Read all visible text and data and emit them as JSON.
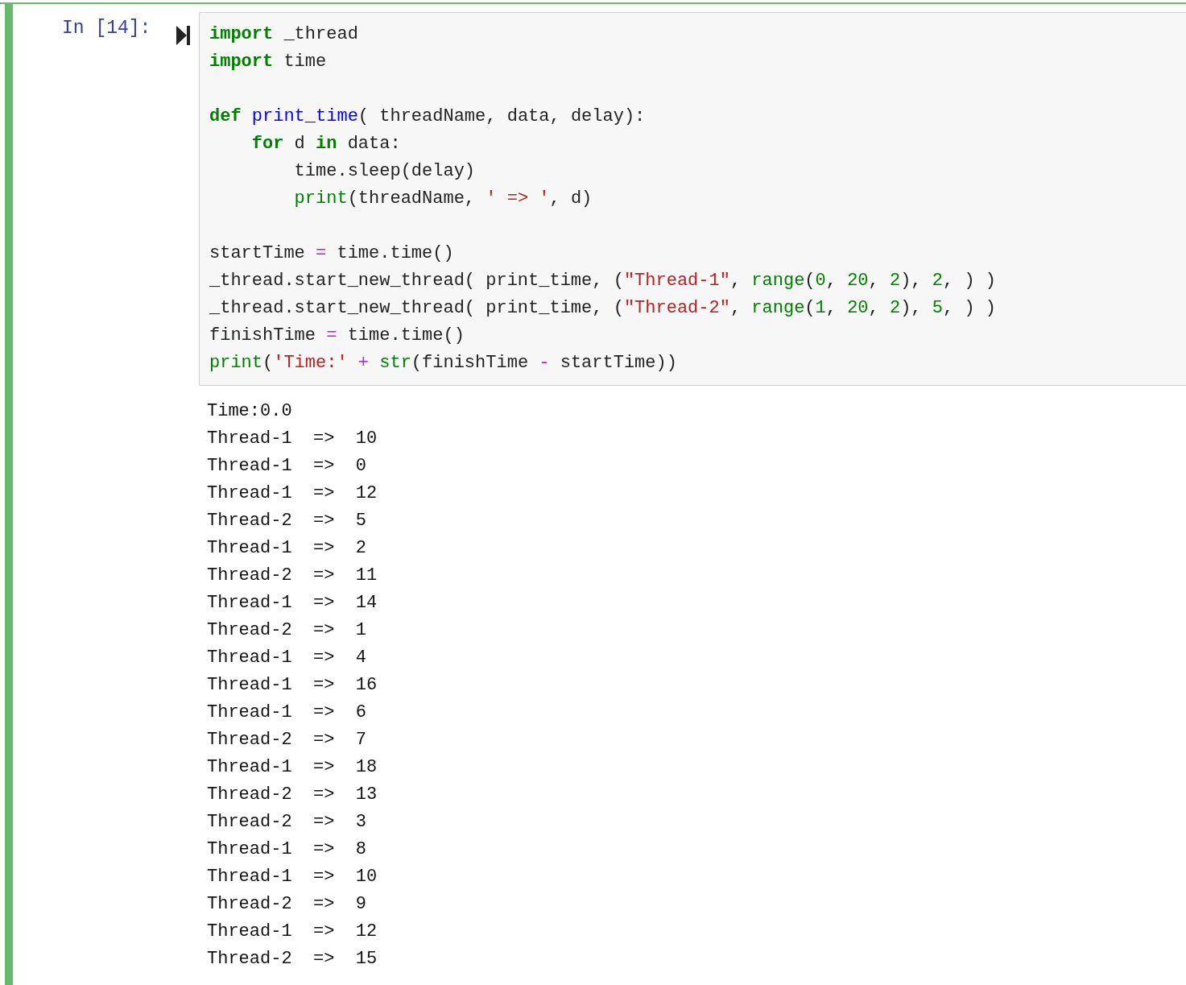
{
  "cell": {
    "prompt": "In [14]:",
    "code_lines": [
      {
        "kind": "code",
        "tokens": [
          {
            "kind": "keyword",
            "text": "import"
          },
          {
            "kind": "plain",
            "text": " _thread"
          }
        ]
      },
      {
        "kind": "code",
        "tokens": [
          {
            "kind": "keyword",
            "text": "import"
          },
          {
            "kind": "plain",
            "text": " time"
          }
        ]
      },
      {
        "kind": "blank"
      },
      {
        "kind": "code",
        "tokens": [
          {
            "kind": "keyword",
            "text": "def"
          },
          {
            "kind": "function",
            "text": " print_time"
          },
          {
            "kind": "plain",
            "text": "( threadName, data, delay):"
          }
        ]
      },
      {
        "kind": "code",
        "tokens": [
          {
            "kind": "keyword",
            "text": "    for"
          },
          {
            "kind": "plain",
            "text": " d "
          },
          {
            "kind": "keyword",
            "text": "in"
          },
          {
            "kind": "plain",
            "text": " data:"
          }
        ]
      },
      {
        "kind": "code",
        "tokens": [
          {
            "kind": "plain",
            "text": "        time.sleep(delay)"
          }
        ]
      },
      {
        "kind": "code",
        "tokens": [
          {
            "kind": "builtin",
            "text": "        print"
          },
          {
            "kind": "plain",
            "text": "(threadName, "
          },
          {
            "kind": "string",
            "text": "' => '"
          },
          {
            "kind": "plain",
            "text": ", d)"
          }
        ]
      },
      {
        "kind": "blank"
      },
      {
        "kind": "code",
        "tokens": [
          {
            "kind": "plain",
            "text": "startTime "
          },
          {
            "kind": "operator",
            "text": "="
          },
          {
            "kind": "plain",
            "text": " time.time()"
          }
        ]
      },
      {
        "kind": "code",
        "tokens": [
          {
            "kind": "plain",
            "text": "_thread.start_new_thread( print_time, ("
          },
          {
            "kind": "string",
            "text": "\"Thread-1\""
          },
          {
            "kind": "plain",
            "text": ", "
          },
          {
            "kind": "builtin",
            "text": "range"
          },
          {
            "kind": "plain",
            "text": "("
          },
          {
            "kind": "number",
            "text": "0"
          },
          {
            "kind": "plain",
            "text": ", "
          },
          {
            "kind": "number",
            "text": "20"
          },
          {
            "kind": "plain",
            "text": ", "
          },
          {
            "kind": "number",
            "text": "2"
          },
          {
            "kind": "plain",
            "text": "), "
          },
          {
            "kind": "number",
            "text": "2"
          },
          {
            "kind": "plain",
            "text": ", ) )"
          }
        ]
      },
      {
        "kind": "code",
        "tokens": [
          {
            "kind": "plain",
            "text": "_thread.start_new_thread( print_time, ("
          },
          {
            "kind": "string",
            "text": "\"Thread-2\""
          },
          {
            "kind": "plain",
            "text": ", "
          },
          {
            "kind": "builtin",
            "text": "range"
          },
          {
            "kind": "plain",
            "text": "("
          },
          {
            "kind": "number",
            "text": "1"
          },
          {
            "kind": "plain",
            "text": ", "
          },
          {
            "kind": "number",
            "text": "20"
          },
          {
            "kind": "plain",
            "text": ", "
          },
          {
            "kind": "number",
            "text": "2"
          },
          {
            "kind": "plain",
            "text": "), "
          },
          {
            "kind": "number",
            "text": "5"
          },
          {
            "kind": "plain",
            "text": ", ) )"
          }
        ]
      },
      {
        "kind": "code",
        "tokens": [
          {
            "kind": "plain",
            "text": "finishTime "
          },
          {
            "kind": "operator",
            "text": "="
          },
          {
            "kind": "plain",
            "text": " time.time()"
          }
        ]
      },
      {
        "kind": "code",
        "tokens": [
          {
            "kind": "builtin",
            "text": "print"
          },
          {
            "kind": "plain",
            "text": "("
          },
          {
            "kind": "string",
            "text": "'Time:'"
          },
          {
            "kind": "operator",
            "text": " + "
          },
          {
            "kind": "builtin",
            "text": "str"
          },
          {
            "kind": "plain",
            "text": "(finishTime "
          },
          {
            "kind": "operator",
            "text": "-"
          },
          {
            "kind": "plain",
            "text": " startTime))"
          }
        ]
      }
    ],
    "output_lines": [
      "Time:0.0",
      "Thread-1  =>  10",
      "Thread-1  =>  0",
      "Thread-1  =>  12",
      "Thread-2  =>  5",
      "Thread-1  =>  2",
      "Thread-2  =>  11",
      "Thread-1  =>  14",
      "Thread-2  =>  1",
      "Thread-1  =>  4",
      "Thread-1  =>  16",
      "Thread-1  =>  6",
      "Thread-2  =>  7",
      "Thread-1  =>  18",
      "Thread-2  =>  13",
      "Thread-2  =>  3",
      "Thread-1  =>  8",
      "Thread-1  =>  10",
      "Thread-2  =>  9",
      "Thread-1  =>  12",
      "Thread-2  =>  15"
    ]
  }
}
